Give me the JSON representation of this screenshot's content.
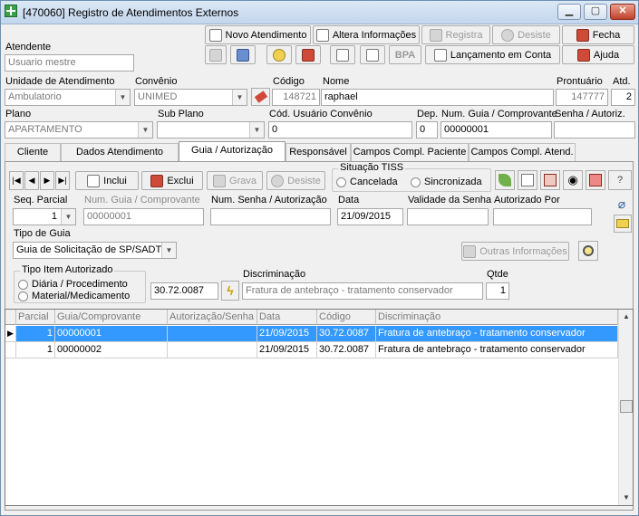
{
  "window": {
    "title": "[470060]  Registro de Atendimentos Externos"
  },
  "toolbar": {
    "novo_atendimento": "Novo Atendimento",
    "altera_informacoes": "Altera Informações",
    "registra": "Registra",
    "desiste": "Desiste",
    "fecha": "Fecha",
    "bpa": "BPA",
    "lancamento_conta": "Lançamento em Conta",
    "ajuda": "Ajuda"
  },
  "header": {
    "atendente_label": "Atendente",
    "atendente_value": "Usuario mestre",
    "unidade_label": "Unidade de Atendimento",
    "unidade_value": "Ambulatorio",
    "convenio_label": "Convênio",
    "convenio_value": "UNIMED",
    "codigo_label": "Código",
    "codigo_value": "148721",
    "nome_label": "Nome",
    "nome_value": "raphael",
    "prontuario_label": "Prontuário",
    "prontuario_value": "147777",
    "atd_label": "Atd.",
    "atd_value": "2",
    "plano_label": "Plano",
    "plano_value": "APARTAMENTO",
    "subplano_label": "Sub Plano",
    "subplano_value": "",
    "cod_usuario_label": "Cód. Usuário Convênio",
    "cod_usuario_value": "0",
    "dep_label": "Dep.",
    "dep_value": "0",
    "num_guia_label": "Num. Guia / Comprovante",
    "num_guia_value": "00000001",
    "senha_label": "Senha / Autoriz.",
    "senha_value": ""
  },
  "tabs": [
    {
      "label": "Cliente"
    },
    {
      "label": "Dados Atendimento"
    },
    {
      "label": "Guia / Autorização"
    },
    {
      "label": "Responsável"
    },
    {
      "label": "Campos Compl. Paciente"
    },
    {
      "label": "Campos Compl. Atend."
    }
  ],
  "guia": {
    "nav": [
      "|◀",
      "◀",
      "▶",
      "▶|"
    ],
    "inclui": "Inclui",
    "exclui": "Exclui",
    "grava": "Grava",
    "desiste": "Desiste",
    "situacao_title": "Situação TISS",
    "cancelada": "Cancelada",
    "sincronizada": "Sincronizada",
    "seq_parcial_label": "Seq. Parcial",
    "seq_parcial_value": "1",
    "num_guia_label": "Num. Guia / Comprovante",
    "num_guia_value": "00000001",
    "num_senha_label": "Num. Senha / Autorização",
    "num_senha_value": "",
    "data_label": "Data",
    "data_value": "21/09/2015",
    "validade_label": "Validade da Senha",
    "validade_value": "",
    "autorizado_label": "Autorizado Por",
    "autorizado_value": "",
    "tipo_guia_label": "Tipo de Guia",
    "tipo_guia_value": "Guia de Solicitação de SP/SADT",
    "outras_info": "Outras Informações",
    "tipo_item_title": "Tipo Item Autorizado",
    "diaria": "Diária / Procedimento",
    "material": "Material/Medicamento",
    "codigo_item": "30.72.0087",
    "discriminacao_label": "Discriminação",
    "discriminacao_value": "Fratura de antebraço - tratamento conservador",
    "qtde_label": "Qtde",
    "qtde_value": "1"
  },
  "grid": {
    "columns": [
      "Parcial",
      "Guia/Comprovante",
      "Autorização/Senha",
      "Data",
      "Código",
      "Discriminação"
    ],
    "rows": [
      {
        "parcial": "1",
        "guia": "00000001",
        "autorizacao": "",
        "data": "21/09/2015",
        "codigo": "30.72.0087",
        "discriminacao": "Fratura de antebraço - tratamento conservador"
      },
      {
        "parcial": "1",
        "guia": "00000002",
        "autorizacao": "",
        "data": "21/09/2015",
        "codigo": "30.72.0087",
        "discriminacao": "Fratura de antebraço - tratamento conservador"
      }
    ]
  },
  "colors": {
    "selection": "#3399ff",
    "window_bg": "#f0f0f0",
    "title_gradient": "#c3d6ec"
  }
}
